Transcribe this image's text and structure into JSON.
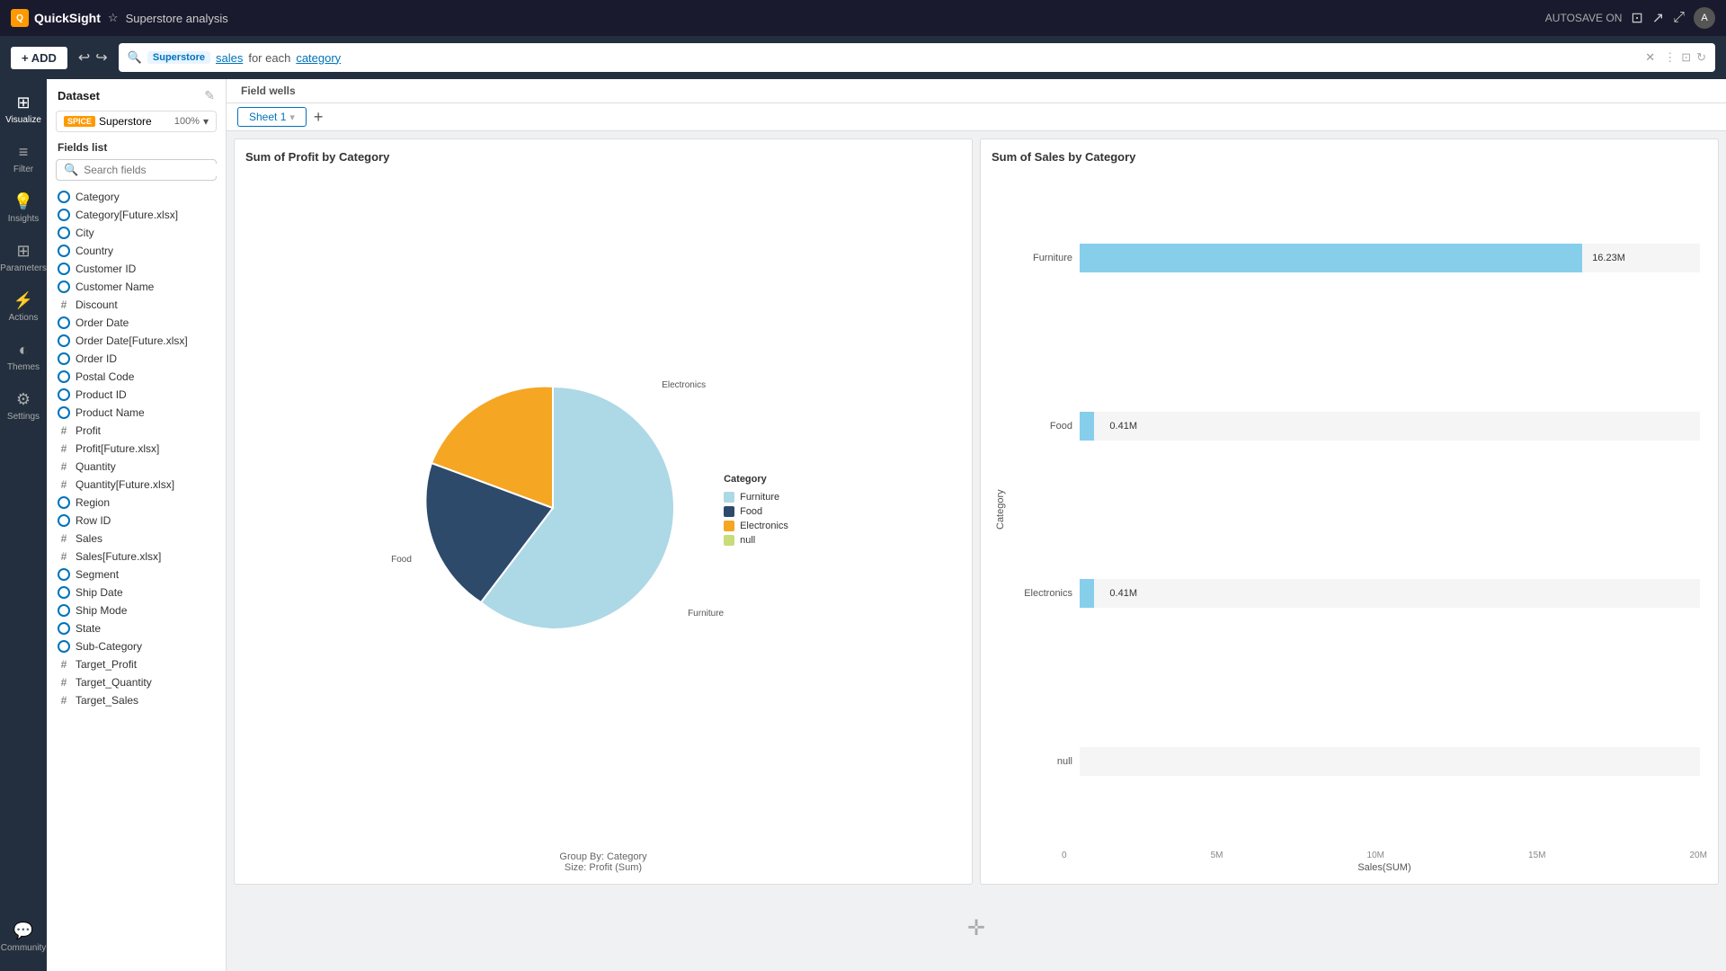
{
  "topbar": {
    "logo": "QuickSight",
    "analysis_name": "Superstore analysis",
    "user_icon": "A"
  },
  "toolbar": {
    "add_label": "+ ADD",
    "search_dataset": "Superstore",
    "search_field": "sales",
    "search_suffix": "for each",
    "search_group": "category",
    "autosave": "AUTOSAVE ON"
  },
  "icon_sidebar": {
    "items": [
      {
        "id": "visualize",
        "label": "Visualize",
        "icon": "⊞"
      },
      {
        "id": "filter",
        "label": "Filter",
        "icon": "≡"
      },
      {
        "id": "insights",
        "label": "Insights",
        "icon": "●"
      },
      {
        "id": "parameters",
        "label": "Parameters",
        "icon": "⊞"
      },
      {
        "id": "actions",
        "label": "Actions",
        "icon": "⚡"
      },
      {
        "id": "themes",
        "label": "Themes",
        "icon": "◐"
      },
      {
        "id": "settings",
        "label": "Settings",
        "icon": "⚙"
      },
      {
        "id": "community",
        "label": "Community",
        "icon": "💬"
      }
    ]
  },
  "fields_panel": {
    "dataset_label": "Dataset",
    "spice_badge": "SPICE",
    "dataset_name": "Superstore",
    "dataset_pct": "100%",
    "fields_list_label": "Fields list",
    "search_placeholder": "Search fields",
    "fields": [
      {
        "name": "Category",
        "type": "dim"
      },
      {
        "name": "Category[Future.xlsx]",
        "type": "dim"
      },
      {
        "name": "City",
        "type": "dim"
      },
      {
        "name": "Country",
        "type": "dim"
      },
      {
        "name": "Customer ID",
        "type": "dim"
      },
      {
        "name": "Customer Name",
        "type": "dim"
      },
      {
        "name": "Discount",
        "type": "measure"
      },
      {
        "name": "Order Date",
        "type": "dim"
      },
      {
        "name": "Order Date[Future.xlsx]",
        "type": "dim"
      },
      {
        "name": "Order ID",
        "type": "dim"
      },
      {
        "name": "Postal Code",
        "type": "dim"
      },
      {
        "name": "Product ID",
        "type": "dim"
      },
      {
        "name": "Product Name",
        "type": "dim"
      },
      {
        "name": "Profit",
        "type": "measure"
      },
      {
        "name": "Profit[Future.xlsx]",
        "type": "measure"
      },
      {
        "name": "Quantity",
        "type": "measure"
      },
      {
        "name": "Quantity[Future.xlsx]",
        "type": "measure"
      },
      {
        "name": "Region",
        "type": "dim"
      },
      {
        "name": "Row ID",
        "type": "dim"
      },
      {
        "name": "Sales",
        "type": "measure"
      },
      {
        "name": "Sales[Future.xlsx]",
        "type": "measure"
      },
      {
        "name": "Segment",
        "type": "dim"
      },
      {
        "name": "Ship Date",
        "type": "dim"
      },
      {
        "name": "Ship Mode",
        "type": "dim"
      },
      {
        "name": "State",
        "type": "dim"
      },
      {
        "name": "Sub-Category",
        "type": "dim"
      },
      {
        "name": "Target_Profit",
        "type": "measure"
      },
      {
        "name": "Target_Quantity",
        "type": "measure"
      },
      {
        "name": "Target_Sales",
        "type": "measure"
      }
    ]
  },
  "field_wells": {
    "label": "Field wells"
  },
  "sheets": {
    "tabs": [
      {
        "label": "Sheet 1",
        "active": true
      }
    ],
    "add_label": "+"
  },
  "pie_chart": {
    "title": "Sum of Profit by Category",
    "group_by": "Group By: Category",
    "size": "Size: Profit (Sum)",
    "legend_title": "Category",
    "legend": [
      {
        "label": "Furniture",
        "color": "#add8e6"
      },
      {
        "label": "Food",
        "color": "#2d4a6b"
      },
      {
        "label": "Electronics",
        "color": "#f5a623"
      },
      {
        "label": "null",
        "color": "#c8dc78"
      }
    ],
    "slices": [
      {
        "label": "Electronics",
        "color": "#f5a623",
        "pct": 20
      },
      {
        "label": "Food",
        "color": "#2d4a6b",
        "pct": 22
      },
      {
        "label": "Furniture",
        "color": "#add8e6",
        "pct": 58
      }
    ]
  },
  "bar_chart": {
    "title": "Sum of Sales by Category",
    "y_axis_label": "Category",
    "x_axis_label": "Sales(SUM)",
    "x_ticks": [
      "0",
      "5M",
      "10M",
      "15M",
      "20M"
    ],
    "bars": [
      {
        "label": "Furniture",
        "value": "16.23M",
        "pct": 81
      },
      {
        "label": "Food",
        "value": "0.41M",
        "pct": 2
      },
      {
        "label": "Electronics",
        "value": "0.41M",
        "pct": 2
      },
      {
        "label": "null",
        "value": "",
        "pct": 0
      }
    ],
    "color": "#87ceeb"
  },
  "canvas": {
    "move_icon": "✛"
  }
}
